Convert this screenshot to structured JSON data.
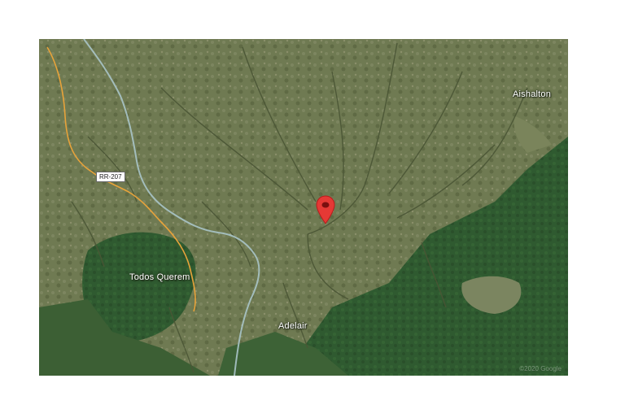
{
  "map": {
    "type": "satellite",
    "places": {
      "aishalton": "Aishalton",
      "todos_querem": "Todos Querem",
      "adelair": "Adelair"
    },
    "road_shield": "RR-207",
    "marker_icon": "map-pin-icon",
    "marker_color": "#e53935",
    "copyright": "©2020 Google"
  }
}
